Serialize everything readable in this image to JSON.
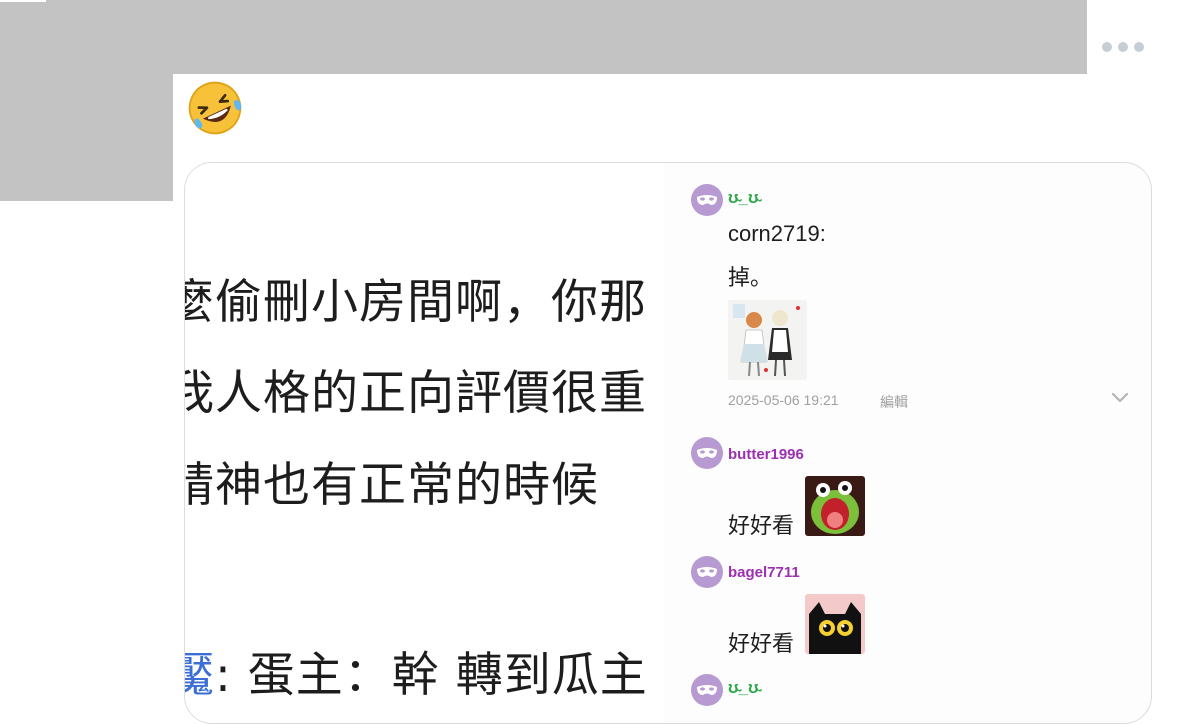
{
  "header": {
    "more_icon": "more-horizontal-icon"
  },
  "reaction_emoji": "rolling-on-floor-laughing",
  "screenshot_text": {
    "line1": "麼偷刪小房間啊，你那",
    "line2": "我人格的正向評價很重",
    "line3": "精神也有正常的時候",
    "line4_name": "魘",
    "line4_rest": ": 蛋主：幹 轉到瓜主"
  },
  "comments": [
    {
      "username": "ʊ̴_ʊ̴",
      "text_line1": "corn2719:",
      "text_line2": "掉。",
      "timestamp": "2025-05-06 19:21",
      "edit_label": "編輯"
    },
    {
      "username": "butter1996",
      "text": "好好看"
    },
    {
      "username": "bagel7711",
      "text": "好好看"
    },
    {
      "username": "ʊ̴_ʊ̴"
    }
  ],
  "colors": {
    "username": "#9c2fb0",
    "username_alt": "#2ea84a",
    "avatar": "#b79ad1",
    "redaction": "#c3c3c3"
  }
}
